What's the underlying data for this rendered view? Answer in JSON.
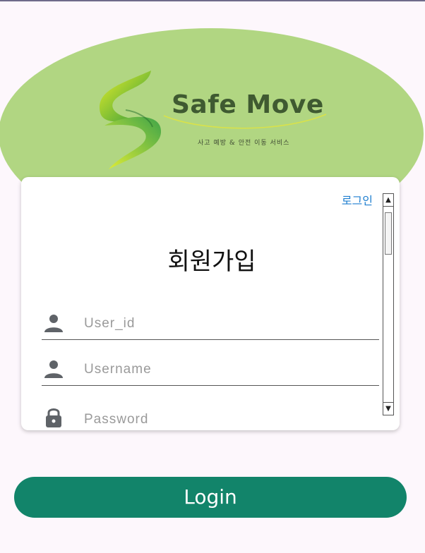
{
  "brand": {
    "name": "Safe Move",
    "tagline": "사고 예방 & 안전 이동 서비스"
  },
  "card": {
    "login_link": "로그인",
    "title": "회원가입",
    "fields": [
      {
        "placeholder": "User_id",
        "icon": "person-icon"
      },
      {
        "placeholder": "Username",
        "icon": "person-icon"
      },
      {
        "placeholder": "Password",
        "icon": "lock-icon"
      }
    ]
  },
  "primary_button": {
    "label": "Login"
  },
  "colors": {
    "hero": "#b1d682",
    "primary": "#12846a",
    "link": "#1f7fd0",
    "brand_text": "#3f5a31"
  }
}
